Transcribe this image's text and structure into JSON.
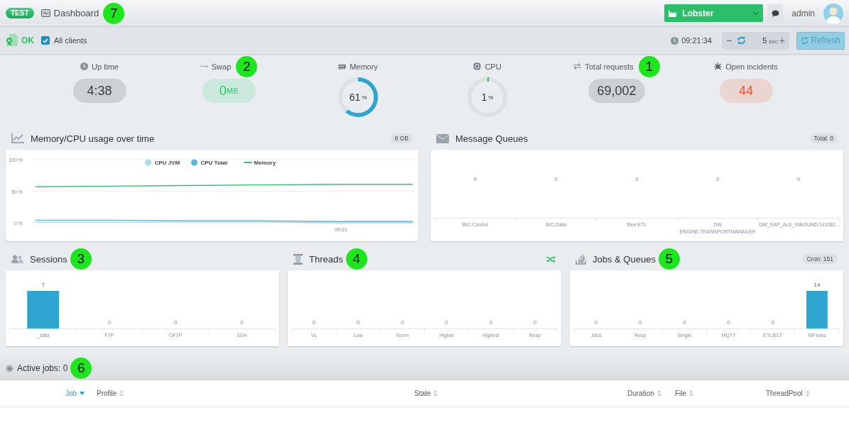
{
  "header": {
    "env_badge": "TEST",
    "title": "Dashboard",
    "callout": "7",
    "company": "Lobster",
    "user": "admin"
  },
  "toolbar": {
    "status": "OK",
    "all_clients": {
      "label": "All clients",
      "checked": true
    },
    "time": "09:21:34",
    "interval": {
      "decrease": "−",
      "value": "5",
      "unit": "sec",
      "increase": "+"
    },
    "refresh": "Refresh"
  },
  "stats": [
    {
      "kind": "pill",
      "label": "Up time",
      "value": "4:38",
      "color": "#3a3f45"
    },
    {
      "kind": "pill",
      "label": "Swap",
      "value": "0",
      "unit": "MB",
      "color": "#2ecc71",
      "callout": "2"
    },
    {
      "kind": "gauge",
      "label": "Memory",
      "value": "61",
      "unit": "%"
    },
    {
      "kind": "gauge",
      "label": "CPU",
      "value": "1",
      "unit": "%"
    },
    {
      "kind": "pill",
      "label": "Total requests",
      "value": "69,002",
      "color": "#3a3f45",
      "callout": "1"
    },
    {
      "kind": "pill",
      "label": "Open incidents",
      "value": "44",
      "color": "#f0542d"
    }
  ],
  "top_panels": [
    {
      "title": "Memory/CPU usage over time",
      "badge": "6 GB",
      "time_label": "09:21",
      "chart_data": {
        "type": "line",
        "categories": [
          null,
          null,
          null,
          null,
          null,
          null
        ],
        "ylim": [
          0,
          100
        ],
        "yticks": [
          {
            "value": 0,
            "label": "0 %"
          },
          {
            "value": 50,
            "label": "50 %"
          },
          {
            "value": 100,
            "label": "100 %"
          }
        ],
        "legend": "top",
        "series": [
          {
            "name": "CPU JVM",
            "color": "#a9dbea",
            "values": [
              1,
              1,
              1,
              1,
              0,
              0
            ]
          },
          {
            "name": "CPU Total",
            "color": "#5bb5d8",
            "values": [
              4,
              4,
              3,
              3,
              2,
              2
            ]
          },
          {
            "name": "Memory",
            "color": "#2ec26a",
            "values": [
              57,
              58,
              59,
              60,
              61,
              61
            ]
          }
        ]
      }
    },
    {
      "title": "Message Queues",
      "badge": "Total: 0",
      "chart_data": {
        "type": "other",
        "categories": [
          "BIC:Control",
          "BIC:Data",
          "Bee:ETL",
          "DW ENGINE:TRANSPORTMANAGER",
          "DW_SAP_ALE_INBOUND:143381…"
        ],
        "values": [
          0,
          0,
          0,
          0,
          0
        ],
        "data_labels": true
      }
    }
  ],
  "bottom_panels": [
    {
      "title": "Sessions",
      "callout": "3",
      "chart_data": {
        "type": "bar",
        "categories": [
          "_data",
          "FTP",
          "OFTP",
          "SSH"
        ],
        "values": [
          7,
          0,
          0,
          0
        ],
        "data_labels": true
      }
    },
    {
      "title": "Threads",
      "callout": "4",
      "action": true,
      "chart_data": {
        "type": "other",
        "categories": [
          "VL",
          "Low",
          "Norm",
          "Higher",
          "Highest",
          "Resp"
        ],
        "values": [
          0,
          0,
          0,
          0,
          0,
          0
        ],
        "data_labels": true
      }
    },
    {
      "title": "Jobs & Queues",
      "callout": "5",
      "badge": "Cron: 151",
      "chart_data": {
        "type": "bar",
        "categories": [
          "Jobs",
          "Resp",
          "Single",
          "MQTT",
          "ETL/ELT",
          "WFlows"
        ],
        "values": [
          0,
          0,
          0,
          0,
          0,
          14
        ],
        "data_labels": true
      }
    }
  ],
  "active_jobs": {
    "title": "Active jobs: 0",
    "callout": "6",
    "columns": [
      {
        "label": "Job",
        "sorted": true
      },
      {
        "label": "Profile",
        "sorted": false
      },
      {
        "label": "State",
        "sorted": false
      },
      {
        "label": "Duration",
        "sorted": false
      },
      {
        "label": "File",
        "sorted": false
      },
      {
        "label": "ThreadPool",
        "sorted": false
      }
    ]
  }
}
